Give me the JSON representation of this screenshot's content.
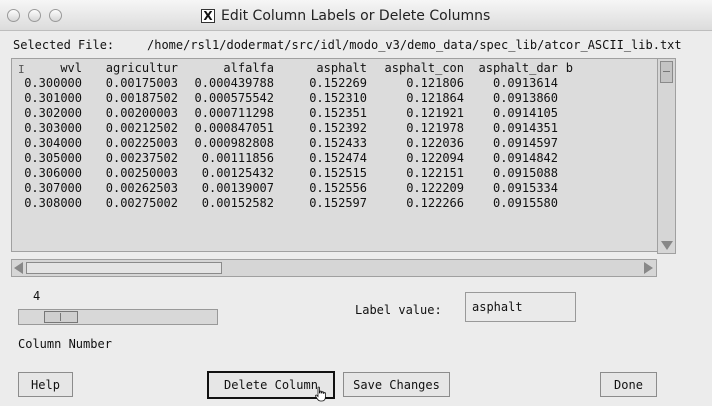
{
  "window": {
    "title": "Edit Column Labels or Delete Columns",
    "title_icon": "X"
  },
  "file": {
    "label": "Selected File:",
    "path": "/home/rsl1/dodermat/src/idl/modo_v3/demo_data/spec_lib/atcor_ASCII_lib.txt"
  },
  "table": {
    "headers": [
      "wvl",
      "agricultur",
      "alfalfa",
      "asphalt",
      "asphalt_con",
      "asphalt_dar",
      "b"
    ],
    "rows": [
      [
        "0.300000",
        "0.00175003",
        "0.000439788",
        "0.152269",
        "0.121806",
        "0.0913614",
        ""
      ],
      [
        "0.301000",
        "0.00187502",
        "0.000575542",
        "0.152310",
        "0.121864",
        "0.0913860",
        ""
      ],
      [
        "0.302000",
        "0.00200003",
        "0.000711298",
        "0.152351",
        "0.121921",
        "0.0914105",
        ""
      ],
      [
        "0.303000",
        "0.00212502",
        "0.000847051",
        "0.152392",
        "0.121978",
        "0.0914351",
        ""
      ],
      [
        "0.304000",
        "0.00225003",
        "0.000982808",
        "0.152433",
        "0.122036",
        "0.0914597",
        ""
      ],
      [
        "0.305000",
        "0.00237502",
        "0.00111856",
        "0.152474",
        "0.122094",
        "0.0914842",
        ""
      ],
      [
        "0.306000",
        "0.00250003",
        "0.00125432",
        "0.152515",
        "0.122151",
        "0.0915088",
        ""
      ],
      [
        "0.307000",
        "0.00262503",
        "0.00139007",
        "0.152556",
        "0.122209",
        "0.0915334",
        ""
      ],
      [
        "0.308000",
        "0.00275002",
        "0.00152582",
        "0.152597",
        "0.122266",
        "0.0915580",
        ""
      ]
    ]
  },
  "slider": {
    "value": "4",
    "label": "Column Number",
    "max": 6
  },
  "label_value": {
    "label": "Label value:",
    "value": "asphalt"
  },
  "buttons": {
    "help": "Help",
    "delete": "Delete Column",
    "save": "Save Changes",
    "done": "Done"
  }
}
